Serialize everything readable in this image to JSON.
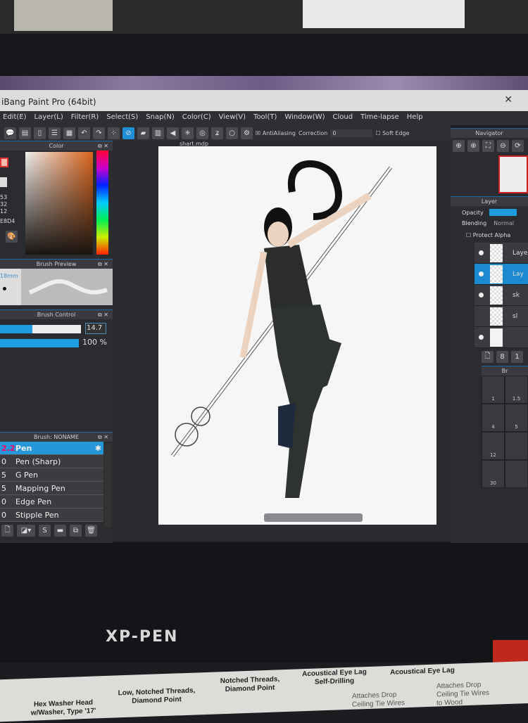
{
  "app": {
    "title": "iBang Paint Pro (64bit)",
    "close_icon": "close-icon"
  },
  "menu": [
    "Edit(E)",
    "Layer(L)",
    "Filter(R)",
    "Select(S)",
    "Snap(N)",
    "Color(C)",
    "View(V)",
    "Tool(T)",
    "Window(W)",
    "Cloud",
    "Time-lapse",
    "Help"
  ],
  "toolbar": {
    "antialiasing": "AntiAliasing",
    "correction_label": "Correction",
    "correction_value": "0",
    "soft_edge": "Soft Edge"
  },
  "color_panel": {
    "title": "Color",
    "values": [
      "53",
      "32",
      "12"
    ],
    "hex": "E8D4",
    "accent": "#1f8fd6"
  },
  "brush_preview": {
    "title": "Brush Preview",
    "size": "18mm"
  },
  "brush_control": {
    "title": "Brush Control",
    "width_value": "14.7",
    "opacity_value": "100 %",
    "width_fraction": 0.4,
    "opacity_fraction": 1.0
  },
  "brush_list": {
    "title": "Brush: NONAME",
    "items": [
      {
        "size": "2.2",
        "name": "Pen",
        "selected": true
      },
      {
        "size": "0",
        "name": "Pen (Sharp)"
      },
      {
        "size": "5",
        "name": "G Pen"
      },
      {
        "size": "5",
        "name": "Mapping Pen"
      },
      {
        "size": "0",
        "name": "Edge Pen"
      },
      {
        "size": "0",
        "name": "Stipple Pen"
      }
    ]
  },
  "document": {
    "tab": "shart.mdp"
  },
  "navigator": {
    "title": "Navigator"
  },
  "layer_panel": {
    "title": "Layer",
    "opacity_label": "Opacity",
    "blending_label": "Blending",
    "blending_value": "Normal",
    "protect_alpha": "Protect Alpha",
    "layers": [
      {
        "name": "Laye"
      },
      {
        "name": "Lay",
        "selected": true
      },
      {
        "name": "sk"
      },
      {
        "name": "sl"
      },
      {
        "name": ""
      }
    ]
  },
  "brush_sizes": {
    "title": "Br",
    "sizes": [
      "1",
      "1.5",
      "4",
      "5",
      "12",
      "",
      "30",
      ""
    ]
  },
  "device": {
    "brand": "XP-PEN"
  },
  "sticker": {
    "labels": [
      "Hex Washer Head w/Washer, Type '17'",
      "Low, Notched Threads, Diamond Point",
      "Notched Threads, Diamond Point",
      "Acoustical Eye Lag Self-Drilling",
      "Acoustical Eye Lag"
    ],
    "notes": [
      "Attaches Drop Ceiling Tie Wires",
      "Attaches Drop Ceiling Tie Wires to Wood"
    ]
  }
}
